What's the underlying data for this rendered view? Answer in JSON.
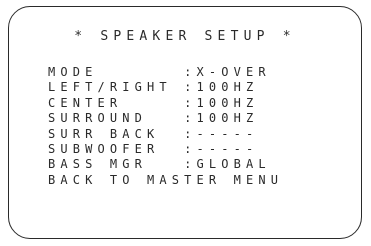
{
  "screen": {
    "title": "* SPEAKER SETUP *"
  },
  "menu": [
    {
      "label": "MODE",
      "pad": "       ",
      "sep": ":",
      "value": "X-OVER"
    },
    {
      "label": "LEFT/RIGHT",
      "pad": " ",
      "sep": ":",
      "value": "100HZ"
    },
    {
      "label": "CENTER",
      "pad": "     ",
      "sep": ":",
      "value": "100HZ"
    },
    {
      "label": "SURROUND",
      "pad": "   ",
      "sep": ":",
      "value": "100HZ"
    },
    {
      "label": "SURR BACK",
      "pad": "  ",
      "sep": ":",
      "value": "-----"
    },
    {
      "label": "SUBWOOFER",
      "pad": "  ",
      "sep": ":",
      "value": "-----"
    },
    {
      "label": "BASS MGR",
      "pad": "   ",
      "sep": ":",
      "value": "GLOBAL"
    },
    {
      "label": "BACK TO MASTER MENU",
      "pad": "",
      "sep": "",
      "value": ""
    }
  ]
}
